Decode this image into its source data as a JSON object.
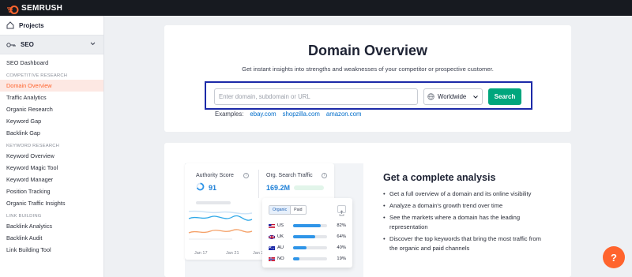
{
  "brand": {
    "name": "SEMRUSH",
    "accent": "#ff642d"
  },
  "sidebar": {
    "projects_label": "Projects",
    "seo_label": "SEO",
    "dashboard": "SEO Dashboard",
    "sections": [
      {
        "title": "COMPETITIVE RESEARCH",
        "items": [
          "Domain Overview",
          "Traffic Analytics",
          "Organic Research",
          "Keyword Gap",
          "Backlink Gap"
        ]
      },
      {
        "title": "KEYWORD RESEARCH",
        "items": [
          "Keyword Overview",
          "Keyword Magic Tool",
          "Keyword Manager",
          "Position Tracking",
          "Organic Traffic Insights"
        ]
      },
      {
        "title": "LINK BUILDING",
        "items": [
          "Backlink Analytics",
          "Backlink Audit",
          "Link Building Tool"
        ]
      }
    ],
    "active_item": "Domain Overview"
  },
  "overview": {
    "title": "Domain Overview",
    "subtitle": "Get instant insights into strengths and weaknesses of your competitor or prospective customer.",
    "search_placeholder": "Enter domain, subdomain or URL",
    "region": "Worldwide",
    "search_button": "Search",
    "examples_label": "Examples:",
    "examples": [
      "ebay.com",
      "shopzilla.com",
      "amazon.com"
    ]
  },
  "preview": {
    "authority_label": "Authority Score",
    "authority_value": "91",
    "traffic_label": "Org. Search Traffic",
    "traffic_value": "169.2M",
    "x_ticks": [
      "Jan 17",
      "Jan 21",
      "Jan 2"
    ],
    "tabs": [
      "Organic",
      "Paid"
    ],
    "rows": [
      {
        "country": "US",
        "pct": "82%",
        "fill": 0.82
      },
      {
        "country": "UK",
        "pct": "64%",
        "fill": 0.64
      },
      {
        "country": "AU",
        "pct": "40%",
        "fill": 0.4
      },
      {
        "country": "NO",
        "pct": "19%",
        "fill": 0.19
      }
    ]
  },
  "analysis": {
    "title": "Get a complete analysis",
    "bullets": [
      "Get a full overview of a domain and its online visibility",
      "Analyze a domain's growth trend over time",
      "See the markets where a domain has the leading representation",
      "Discover the top keywords that bring the most traffic from the organic and paid channels"
    ]
  },
  "help_label": "?"
}
